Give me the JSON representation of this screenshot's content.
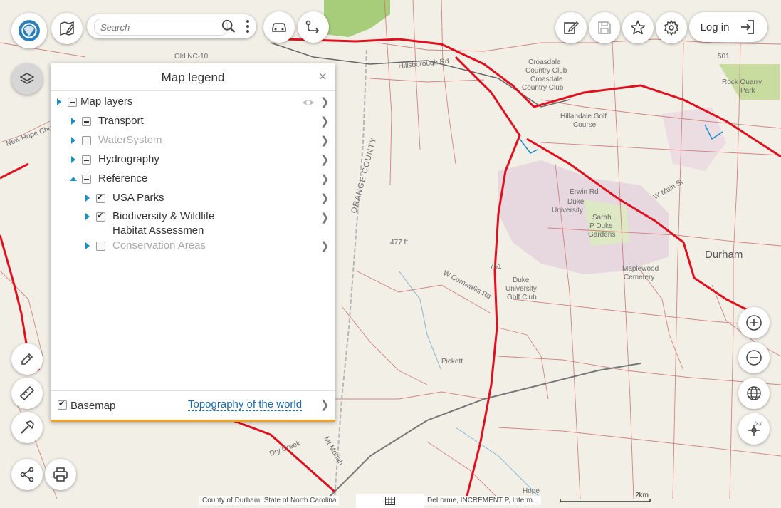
{
  "search": {
    "placeholder": "Search"
  },
  "header": {
    "login_label": "Log in"
  },
  "legend": {
    "title": "Map legend",
    "close": "×",
    "layers": [
      {
        "label": "Map layers",
        "state": "minus",
        "dim": false
      },
      {
        "label": "Transport",
        "state": "minus",
        "dim": false
      },
      {
        "label": "WaterSystem",
        "state": "unchecked",
        "dim": true
      },
      {
        "label": "Hydrography",
        "state": "minus",
        "dim": false
      },
      {
        "label": "Reference",
        "state": "minus",
        "dim": false
      },
      {
        "label": "USA Parks",
        "state": "checked",
        "dim": false
      },
      {
        "label": "Biodiversity & Wildlife",
        "label2": "Habitat Assessmen",
        "state": "checked",
        "dim": false
      },
      {
        "label": "Conservation Areas",
        "state": "unchecked",
        "dim": true
      }
    ],
    "basemap_label": "Basemap",
    "basemap_value": "Topography of the world"
  },
  "map": {
    "labels": {
      "croasdale1": "Croasdale",
      "croasdale2": "Country Club",
      "croasdale3": "Croasdale",
      "croasdale4": "Country Club",
      "hillandale1": "Hillandale Golf",
      "hillandale2": "Course",
      "duke_univ1": "Duke",
      "duke_univ2": "University",
      "sarah1": "Sarah",
      "sarah2": "P Duke",
      "sarah3": "Gardens",
      "durham": "Durham",
      "maplewood1": "Maplewood",
      "maplewood2": "Cemetery",
      "duke_golf1": "Duke",
      "duke_golf2": "University",
      "duke_golf3": "Golf Club",
      "orange_county": "ORANGE COUNTY",
      "elev": "477 ft",
      "hillsborough_rd": "Hillsborough Rd",
      "w_cornwallis": "W Cornwallis Rd",
      "erwin_rd": "Erwin Rd",
      "w_main_st": "W Main St",
      "pickett": "Pickett",
      "hope_ch": "New Hope Church Rd",
      "mt_moriah": "Mt Moriah",
      "dry_creek": "Dry Creek",
      "rock_quarry1": "Rock Quarry",
      "rock_quarry2": "Park",
      "route_nc10": "Old NC-10",
      "route_751": "751",
      "route_501": "501",
      "hope": "Hope"
    },
    "colors": {
      "background": "#f1efe6",
      "road": "#c84848",
      "highway": "#e0101e",
      "park": "#c8dca0",
      "campus": "#e4d4dc"
    },
    "attribution": "County of Durham, State of North Carolina",
    "attribution2": "DeLorme, INCREMENT P, Interm...",
    "scale_label": "2km"
  },
  "icons": [
    "app-logo-icon",
    "edit-map-icon",
    "search-icon",
    "more-vertical-icon",
    "car-icon",
    "route-icon",
    "edit-icon",
    "save-icon",
    "star-icon",
    "gear-icon",
    "login-icon",
    "layers-icon",
    "draw-icon",
    "ruler-icon",
    "hammer-icon",
    "share-icon",
    "print-icon",
    "zoom-in-icon",
    "zoom-out-icon",
    "globe-icon",
    "coordinates-icon",
    "grid-icon"
  ]
}
